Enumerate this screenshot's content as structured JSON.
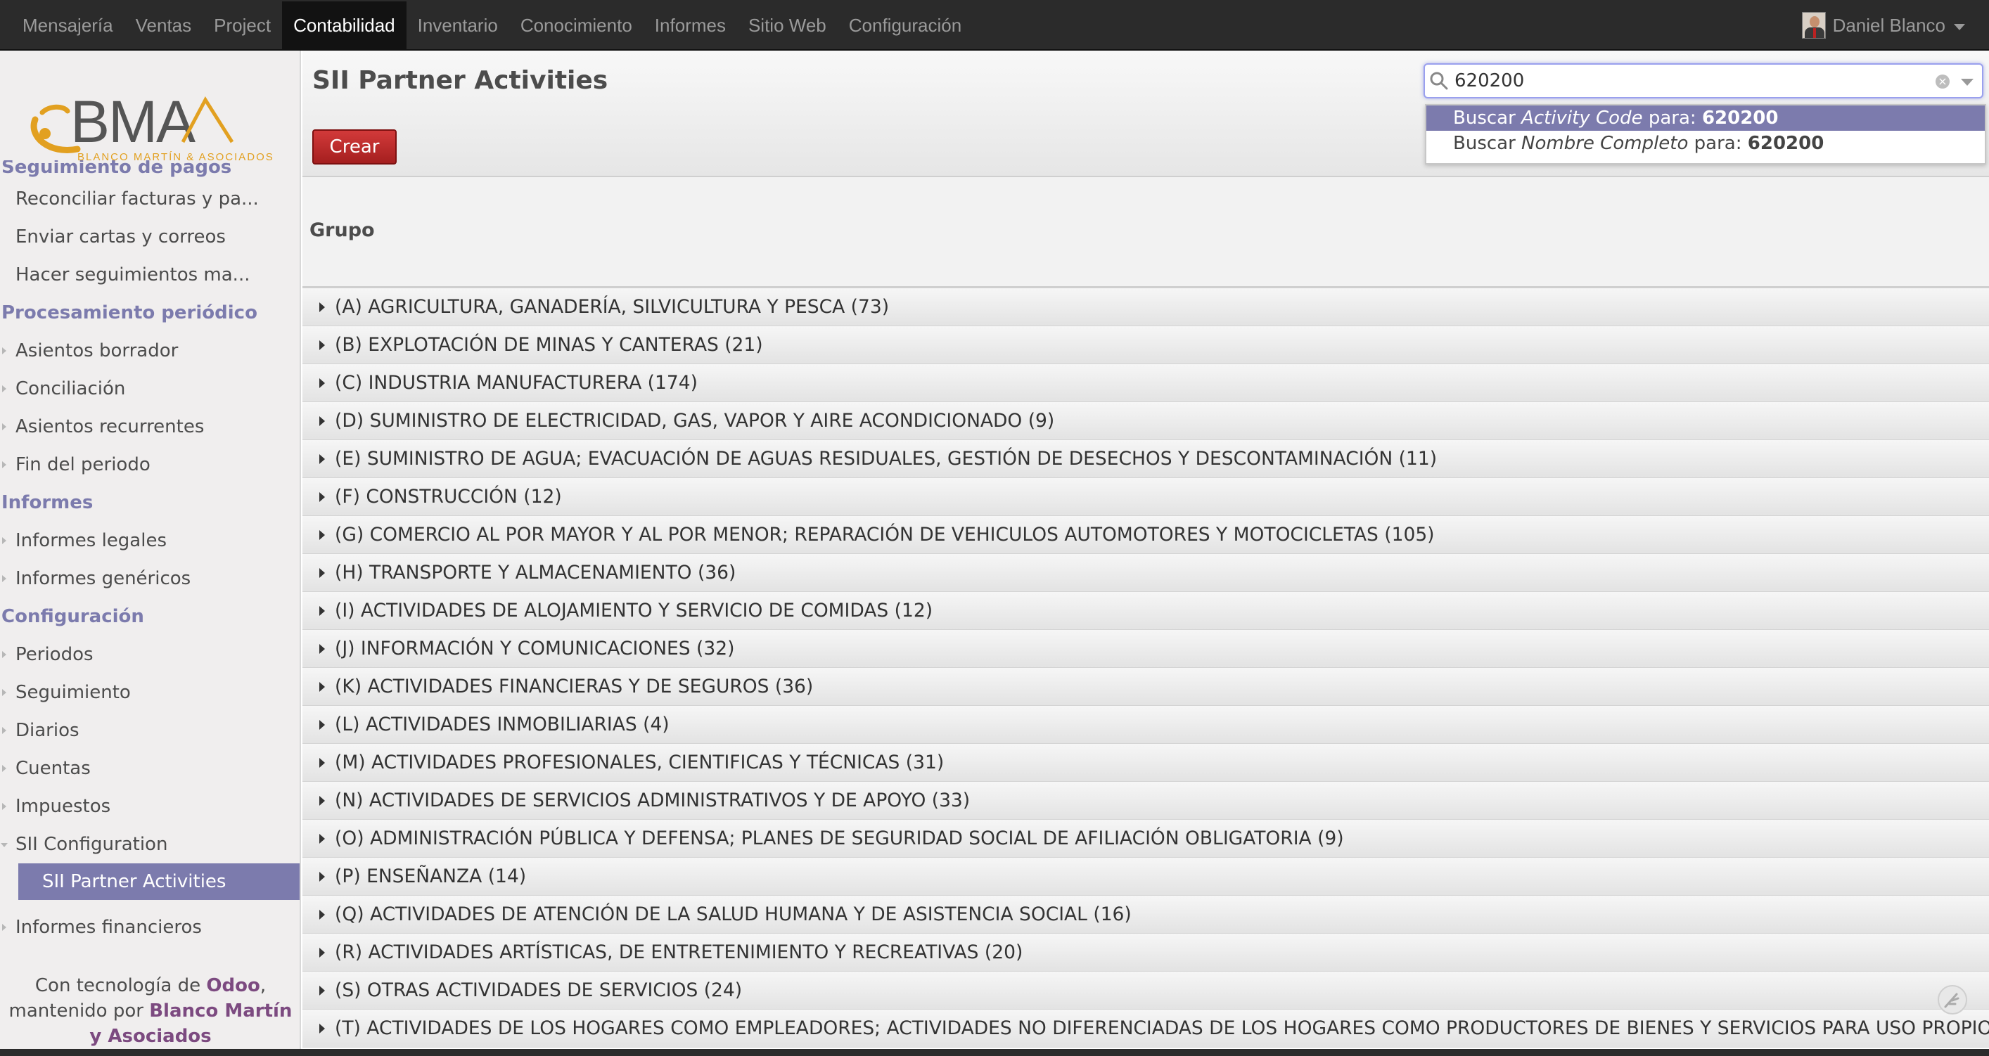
{
  "topbar": {
    "menu": [
      "Mensajería",
      "Ventas",
      "Project",
      "Contabilidad",
      "Inventario",
      "Conocimiento",
      "Informes",
      "Sitio Web",
      "Configuración"
    ],
    "active_menu": "Contabilidad",
    "user_name": "Daniel Blanco"
  },
  "logo": {
    "text": "BMA",
    "tagline": "BLANCO MARTÍN & ASOCIADOS"
  },
  "sidebar": {
    "partial_section": "Seguimiento de pagos",
    "items_top": [
      "Reconciliar facturas y pa...",
      "Enviar cartas y correos",
      "Hacer seguimientos ma..."
    ],
    "section_periodic": "Procesamiento periódico",
    "items_periodic": [
      "Asientos borrador",
      "Conciliación",
      "Asientos recurrentes",
      "Fin del periodo"
    ],
    "section_reports": "Informes",
    "items_reports": [
      "Informes legales",
      "Informes genéricos"
    ],
    "section_config": "Configuración",
    "items_config": [
      "Periodos",
      "Seguimiento",
      "Diarios",
      "Cuentas",
      "Impuestos",
      "SII Configuration"
    ],
    "selected_item": "SII Partner Activities",
    "item_financial": "Informes financieros",
    "footer": {
      "powered_prefix": "Con tecnología de",
      "powered_brand": "Odoo",
      "powered_comma": ",",
      "maintained_prefix": "mantenido por",
      "maintained_brand": "Blanco Martín y Asociados"
    }
  },
  "main": {
    "title": "SII Partner Activities",
    "create_label": "Crear",
    "group_header": "Grupo"
  },
  "search": {
    "value": "620200",
    "suggestions": [
      {
        "prefix": "Buscar",
        "field": "Activity Code",
        "mid": "para:",
        "term": "620200"
      },
      {
        "prefix": "Buscar",
        "field": "Nombre Completo",
        "mid": "para:",
        "term": "620200"
      }
    ]
  },
  "groups": [
    "(A) AGRICULTURA, GANADERÍA, SILVICULTURA Y PESCA (73)",
    "(B) EXPLOTACIÓN DE MINAS Y CANTERAS (21)",
    "(C) INDUSTRIA MANUFACTURERA (174)",
    "(D) SUMINISTRO DE ELECTRICIDAD, GAS, VAPOR Y AIRE ACONDICIONADO (9)",
    "(E) SUMINISTRO DE AGUA; EVACUACIÓN DE AGUAS RESIDUALES, GESTIÓN DE DESECHOS Y DESCONTAMINACIÓN (11)",
    "(F) CONSTRUCCIÓN (12)",
    "(G) COMERCIO AL POR MAYOR Y AL POR MENOR; REPARACIÓN DE VEHICULOS AUTOMOTORES Y MOTOCICLETAS (105)",
    "(H) TRANSPORTE Y ALMACENAMIENTO (36)",
    "(I) ACTIVIDADES DE ALOJAMIENTO Y SERVICIO DE COMIDAS (12)",
    "(J) INFORMACIÓN Y COMUNICACIONES (32)",
    "(K) ACTIVIDADES FINANCIERAS Y DE SEGUROS (36)",
    "(L) ACTIVIDADES INMOBILIARIAS (4)",
    "(M) ACTIVIDADES PROFESIONALES, CIENTIFICAS Y TÉCNICAS (31)",
    "(N) ACTIVIDADES DE SERVICIOS ADMINISTRATIVOS Y DE APOYO (33)",
    "(O) ADMINISTRACIÓN PÚBLICA Y DEFENSA; PLANES DE SEGURIDAD SOCIAL DE AFILIACIÓN OBLIGATORIA (9)",
    "(P) ENSEÑANZA (14)",
    "(Q) ACTIVIDADES DE ATENCIÓN DE LA SALUD HUMANA Y DE ASISTENCIA SOCIAL (16)",
    "(R) ACTIVIDADES ARTÍSTICAS, DE ENTRETENIMIENTO Y RECREATIVAS (20)",
    "(S) OTRAS ACTIVIDADES DE SERVICIOS (24)",
    "(T) ACTIVIDADES DE LOS HOGARES COMO EMPLEADORES; ACTIVIDADES NO DIFERENCIADAS DE LOS HOGARES COMO PRODUCTORES DE BIENES Y SERVICIOS PARA USO PROPIO"
  ],
  "colors": {
    "accent": "#7c7bad",
    "create_button": "#b52525",
    "topbar": "#2b2b2b",
    "brand_text": "#7c4a80"
  },
  "icons": {
    "search": "magnifier-icon",
    "clear": "clear-search-icon",
    "dropdown": "search-dropdown-icon",
    "expander": "group-expand-icon",
    "corner": "feather-icon"
  }
}
